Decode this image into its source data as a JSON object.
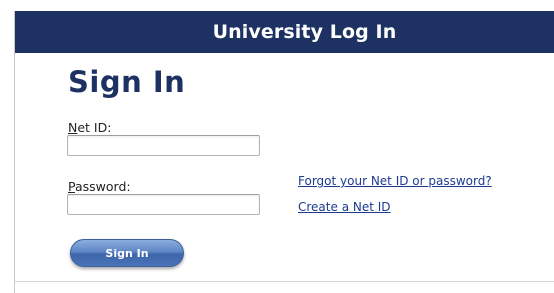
{
  "header": {
    "title": "University Log In",
    "color": "#1d3263"
  },
  "form": {
    "heading": "Sign In",
    "net_id": {
      "label_underlined": "N",
      "label_rest": "et ID:",
      "value": "",
      "placeholder": ""
    },
    "password": {
      "label_underlined": "P",
      "label_rest": "assword:",
      "value": "",
      "placeholder": ""
    },
    "submit_label": "Sign In"
  },
  "links": {
    "forgot": "Forgot your Net ID or password?",
    "create": "Create a Net ID"
  }
}
